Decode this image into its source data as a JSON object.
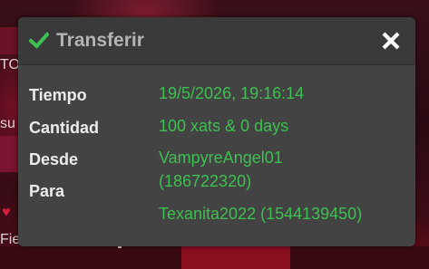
{
  "dialog": {
    "title": "Transferir",
    "check_icon": "check-icon",
    "close_icon": "close-icon",
    "accent_color": "#3cc150",
    "fields": {
      "tiempo_label": "Tiempo",
      "tiempo_value": "19/5/2026, 19:16:14",
      "cantidad_label": "Cantidad",
      "cantidad_value": "100 xats & 0 days",
      "desde_label": "Desde",
      "desde_value_line1": "VampyreAngel01",
      "desde_value_line2": "(186722320)",
      "para_label": "Para",
      "para_value": "Texanita2022 (1544139450)"
    }
  },
  "background": {
    "fragment_top": "TO",
    "fragment_left": "su",
    "fragment_bottom": "Fie"
  }
}
